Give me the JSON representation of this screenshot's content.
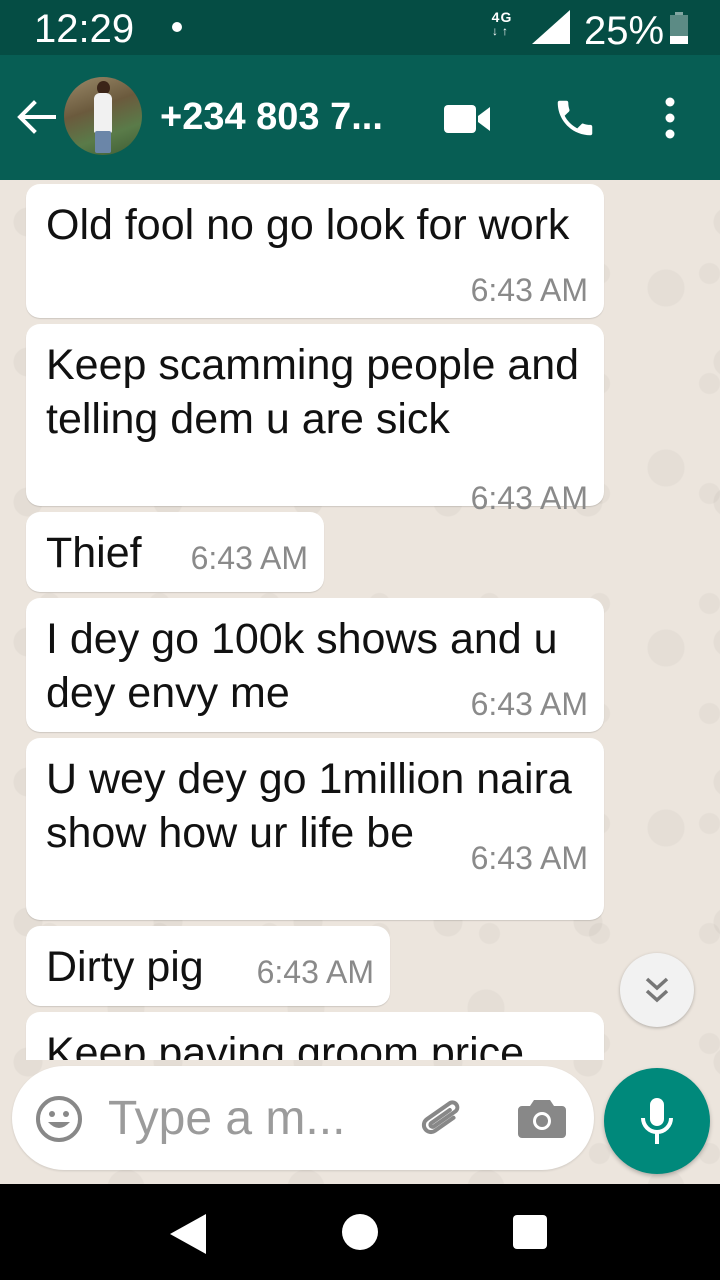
{
  "status_bar": {
    "time": "12:29",
    "network": "4G",
    "battery": "25%"
  },
  "header": {
    "contact_name": "+234 803 7...",
    "icons": [
      "arrow-back-icon",
      "avatar",
      "videocam-icon",
      "phone-icon",
      "more-vert-icon"
    ]
  },
  "messages": [
    {
      "text": "Old fool no go look for work",
      "time": "6:43 AM"
    },
    {
      "text": "Keep scamming people and telling dem u are sick",
      "time": "6:43 AM"
    },
    {
      "text": "Thief",
      "time": "6:43 AM"
    },
    {
      "text": "I dey go 100k shows and u dey envy me",
      "time": "6:43 AM"
    },
    {
      "text": "U wey dey go 1million naira show how ur life be",
      "time": "6:43 AM"
    },
    {
      "text": "Dirty pig",
      "time": "6:43 AM"
    },
    {
      "text": "Keep paying groom price",
      "time": ""
    }
  ],
  "composer": {
    "placeholder": "Type a m...",
    "icons": [
      "emoji-icon",
      "paperclip-icon",
      "camera-icon",
      "mic-icon"
    ]
  },
  "colors": {
    "status_bar": "#054d44",
    "app_bar": "#075e54",
    "chat_background": "#ece5dd",
    "accent": "#00897b"
  }
}
